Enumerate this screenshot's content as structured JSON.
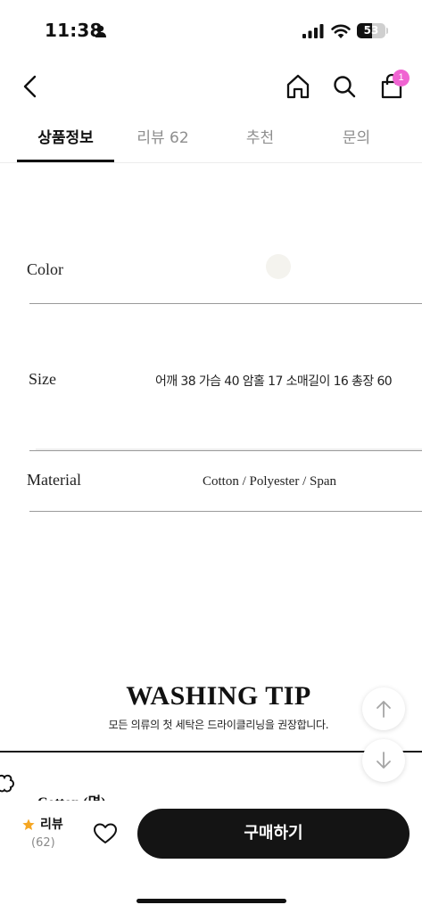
{
  "status_bar": {
    "time": "11:38",
    "battery": "53",
    "battery_level": 0.53
  },
  "nav": {
    "cart_count": "1"
  },
  "tabs": [
    {
      "label": "상품정보",
      "active": true
    },
    {
      "label": "리뷰 62",
      "active": false
    },
    {
      "label": "추천",
      "active": false
    },
    {
      "label": "문의",
      "active": false
    }
  ],
  "specs": {
    "color": {
      "label": "Color",
      "swatch": "#f4f3ee"
    },
    "size": {
      "label": "Size",
      "value": "어깨 38 가슴 40 암홀 17 소매길이 16 총장 60"
    },
    "material": {
      "label": "Material",
      "value": "Cotton / Polyester / Span"
    }
  },
  "washing": {
    "title": "WASHING TIP",
    "subtitle": "모든 의류의 첫 세탁은 드라이클리닝을 권장합니다.",
    "first_item": "Cotton (면)"
  },
  "bottom_bar": {
    "review_label": "리뷰",
    "review_count": "(62)",
    "buy_label": "구매하기"
  },
  "colors": {
    "accent_badge": "#f064d2",
    "star": "#f5a623",
    "buy_button": "#141414"
  }
}
